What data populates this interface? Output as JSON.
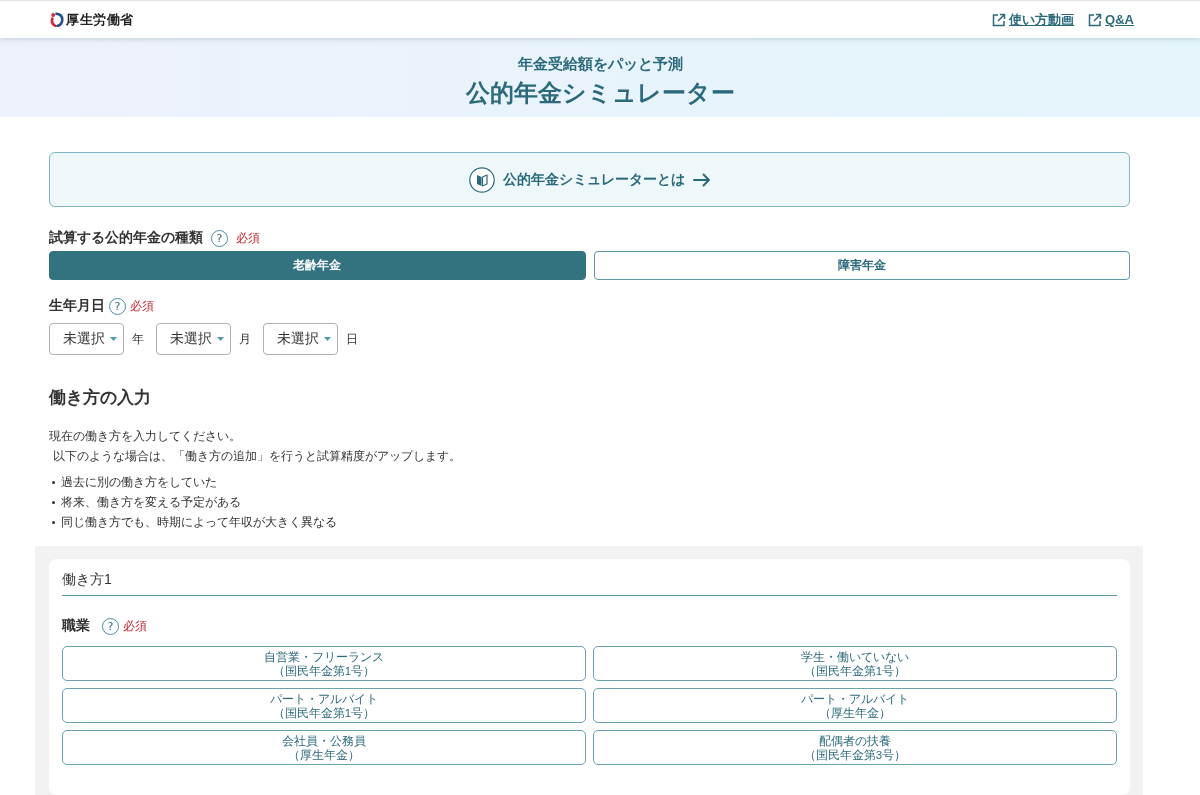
{
  "header": {
    "logo": {
      "name": "厚生労働省"
    },
    "links": [
      {
        "label": "使い方動画"
      },
      {
        "label": "Q&A"
      }
    ]
  },
  "hero": {
    "subtitle": "年金受給額をパッと予測",
    "title": "公的年金シミュレーター"
  },
  "about_banner": {
    "label": "公的年金シミュレーターとは"
  },
  "pension_type": {
    "label": "試算する公的年金の種類",
    "help": "?",
    "required": "必須",
    "options": [
      {
        "label": "老齢年金",
        "selected": true
      },
      {
        "label": "障害年金",
        "selected": false
      }
    ]
  },
  "birth_date": {
    "label": "生年月日",
    "help": "?",
    "required": "必須",
    "fields": [
      {
        "value": "未選択",
        "unit": "年"
      },
      {
        "value": "未選択",
        "unit": "月"
      },
      {
        "value": "未選択",
        "unit": "日"
      }
    ]
  },
  "work_input": {
    "title": "働き方の入力",
    "intro": [
      "現在の働き方を入力してください。",
      "以下のような場合は、「働き方の追加」を行うと試算精度がアップします。"
    ],
    "bullets": [
      "過去に別の働き方をしていた",
      "将来、働き方を変える予定がある",
      "同じ働き方でも、時期によって年収が大きく異なる"
    ]
  },
  "work_card": {
    "title": "働き方1",
    "occupation": {
      "label": "職業",
      "help": "?",
      "required": "必須",
      "options": [
        {
          "lines": [
            "自営業・フリーランス",
            "（国民年金第1号）"
          ],
          "selected": false
        },
        {
          "lines": [
            "学生・働いていない",
            "（国民年金第1号）"
          ],
          "selected": false
        },
        {
          "lines": [
            "パート・アルバイト",
            "（国民年金第1号）"
          ],
          "selected": false
        },
        {
          "lines": [
            "パート・アルバイト",
            "（厚生年金）"
          ],
          "selected": false
        },
        {
          "lines": [
            "会社員・公務員",
            "（厚生年金）"
          ],
          "selected": false
        },
        {
          "lines": [
            "配偶者の扶養",
            "（国民年金第3号）"
          ],
          "selected": false
        }
      ]
    }
  }
}
